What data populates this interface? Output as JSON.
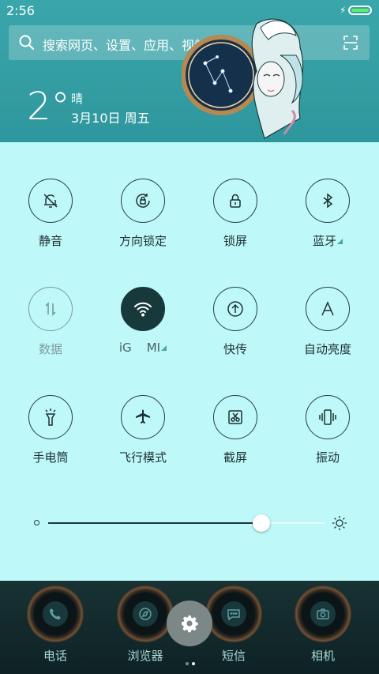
{
  "status": {
    "time": "2:56"
  },
  "search": {
    "placeholder": "搜索网页、设置、应用、视频..."
  },
  "weather": {
    "temp": "2°",
    "condition": "晴",
    "date": "3月10日 周五"
  },
  "tiles": [
    {
      "label": "静音",
      "icon": "bell-off-icon",
      "state": "off"
    },
    {
      "label": "方向锁定",
      "icon": "rotation-lock-icon",
      "state": "off"
    },
    {
      "label": "锁屏",
      "icon": "lock-icon",
      "state": "off"
    },
    {
      "label": "蓝牙",
      "icon": "bluetooth-icon",
      "state": "off",
      "expandable": true
    },
    {
      "label": "数据",
      "icon": "mobile-data-icon",
      "state": "disabled"
    },
    {
      "label": "iG    MI",
      "icon": "wifi-icon",
      "state": "on",
      "expandable": true
    },
    {
      "label": "快传",
      "icon": "upload-icon",
      "state": "off"
    },
    {
      "label": "自动亮度",
      "icon": "auto-brightness-icon",
      "state": "off"
    },
    {
      "label": "手电筒",
      "icon": "flashlight-icon",
      "state": "off"
    },
    {
      "label": "飞行模式",
      "icon": "airplane-icon",
      "state": "off"
    },
    {
      "label": "截屏",
      "icon": "screenshot-icon",
      "state": "off"
    },
    {
      "label": "振动",
      "icon": "vibrate-icon",
      "state": "off"
    }
  ],
  "brightness": {
    "level": 0.77
  },
  "dock": {
    "apps": [
      {
        "label": "电话",
        "icon": "phone-icon"
      },
      {
        "label": "浏览器",
        "icon": "browser-icon"
      },
      {
        "label": "短信",
        "icon": "message-icon"
      },
      {
        "label": "相机",
        "icon": "camera-icon"
      }
    ],
    "pages": 2,
    "current_page": 2
  },
  "colors": {
    "header": "#3aa6ab",
    "panel": "#bff8f8",
    "active_tile": "#17393c",
    "dock": "#0e2225"
  }
}
